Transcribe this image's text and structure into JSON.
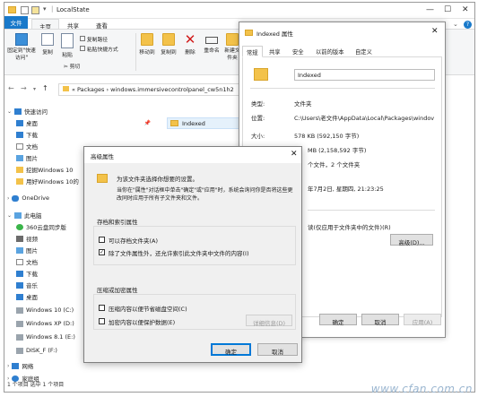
{
  "explorer": {
    "title": "LocalState",
    "ribbon_tabs": [
      "文件",
      "主页",
      "共享",
      "查看"
    ],
    "ribbon": {
      "pin_quick": "固定到\"快速访问\"",
      "copy": "复制",
      "paste": "粘贴",
      "copy_path": "复制路径",
      "paste_shortcut": "粘贴快捷方式",
      "cut": "剪切",
      "move_to": "移动到",
      "copy_to": "复制到",
      "delete": "删除",
      "rename": "重命名",
      "new_folder": "新建文件夹"
    },
    "address": "« Packages › windows.immersivecontrolpanel_cw5n1h2",
    "nav": {
      "quick_access": "快速访问",
      "desktop": "桌面",
      "downloads": "下载",
      "documents": "文档",
      "pictures": "图片",
      "nav_extra_1": "挖掘Windows 10",
      "nav_extra_2": "用好Windows 10的",
      "onedrive": "OneDrive",
      "this_pc": "此电脑",
      "cloud_360": "360云盘同步版",
      "videos": "视频",
      "pictures2": "图片",
      "documents2": "文档",
      "downloads2": "下载",
      "music": "音乐",
      "desktop2": "桌面",
      "drive_c": "Windows 10 (C:)",
      "drive_d": "Windows XP (D:)",
      "drive_e": "Windows 8.1 (E:)",
      "drive_f": "DISK_F (F:)",
      "network": "网络",
      "homegroup": "家庭组"
    },
    "file_item": "Indexed",
    "status_text": "1 个项目    选中 1 个项目"
  },
  "props": {
    "title": "Indexed 属性",
    "tabs": [
      "常规",
      "共享",
      "安全",
      "以前的版本",
      "自定义"
    ],
    "name_value": "Indexed",
    "type_label": "类型:",
    "type_value": "文件夹",
    "location_label": "位置:",
    "location_value": "C:\\Users\\老文件\\AppData\\Local\\Packages\\windov",
    "size_label": "大小:",
    "size_value": "578 KB (592,150 字节)",
    "disk_size_value": "MB (2,158,592 字节)",
    "contains_value": "个文件，2 个文件夹",
    "created_value": "年7月2日, 星期四, 21:23:25",
    "readonly_text": "读(仅应用于文件夹中的文件)(R)",
    "advanced_btn": "高级(D)...",
    "ok": "确定",
    "cancel": "取消",
    "apply": "应用(A)"
  },
  "adv": {
    "title": "高级属性",
    "desc1": "为该文件夹选择你想要的设置。",
    "desc2": "当你在\"属性\"对话框中单击\"确定\"或\"应用\"时，系统会询问你是否将这些更改同时应用于所有子文件夹和文件。",
    "archive_group": "存档和索引属性",
    "archive_check": "可以存档文件夹(A)",
    "index_check": "除了文件属性外，还允许索引此文件夹中文件的内容(I)",
    "compress_group": "压缩或加密属性",
    "compress_check": "压缩内容以便节省磁盘空间(C)",
    "encrypt_check": "加密内容以便保护数据(E)",
    "details_btn": "详细信息(D)",
    "ok": "确定",
    "cancel": "取消"
  },
  "watermark": "www.cfan.com.cn",
  "colors": {
    "accent": "#1979ca",
    "folder": "#f3c24a",
    "selection": "#e5f1fb"
  }
}
